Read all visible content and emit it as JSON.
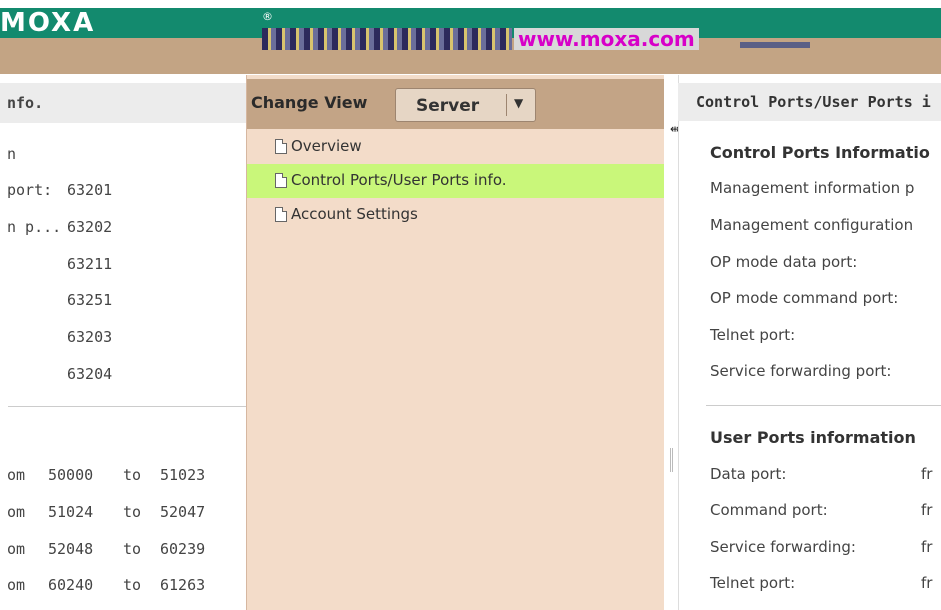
{
  "banner": {
    "logo": "MOXA",
    "reg": "®",
    "tagline": "www.moxa.com"
  },
  "left_panel": {
    "header": "nfo.",
    "section_label": "n",
    "rows": [
      {
        "label": "port:",
        "value": "63201"
      },
      {
        "label": "n p...",
        "value": "63202"
      },
      {
        "label": "",
        "value": "63211"
      },
      {
        "label": "",
        "value": "63251"
      },
      {
        "label": "",
        "value": "63203"
      },
      {
        "label": "",
        "value": "63204"
      }
    ],
    "ranges": [
      {
        "from_label": "om",
        "from": "50000",
        "to_label": "to",
        "to": "51023"
      },
      {
        "from_label": "om",
        "from": "51024",
        "to_label": "to",
        "to": "52047"
      },
      {
        "from_label": "om",
        "from": "52048",
        "to_label": "to",
        "to": "60239"
      },
      {
        "from_label": "om",
        "from": "60240",
        "to_label": "to",
        "to": "61263"
      }
    ]
  },
  "middle_panel": {
    "change_view_label": "Change View",
    "select_value": "Server",
    "select_arrow": "▼",
    "items": [
      {
        "label": "Overview"
      },
      {
        "label": "Control Ports/User Ports info."
      },
      {
        "label": "Account Settings"
      }
    ]
  },
  "right_panel": {
    "header": "Control Ports/User Ports i",
    "control_section": "Control Ports Informatio",
    "control_rows": [
      "Management information p",
      "Management configuration",
      "OP mode data port:",
      "OP mode command port:",
      "Telnet port:",
      "Service forwarding port:"
    ],
    "user_section": "User Ports information",
    "user_rows": [
      {
        "label": "Data port:",
        "from": "fr"
      },
      {
        "label": "Command port:",
        "from": "fr"
      },
      {
        "label": "Service forwarding:",
        "from": "fr"
      },
      {
        "label": "Telnet port:",
        "from": "fr"
      }
    ]
  },
  "splitter": {
    "cursor_glyph": "⇹"
  },
  "colors": {
    "banner_green": "#138a6e",
    "banner_tan": "#c3a484",
    "tagline_magenta": "#d700c8",
    "middle_bg": "#f3dcc9",
    "active_item": "#c9f77a"
  }
}
